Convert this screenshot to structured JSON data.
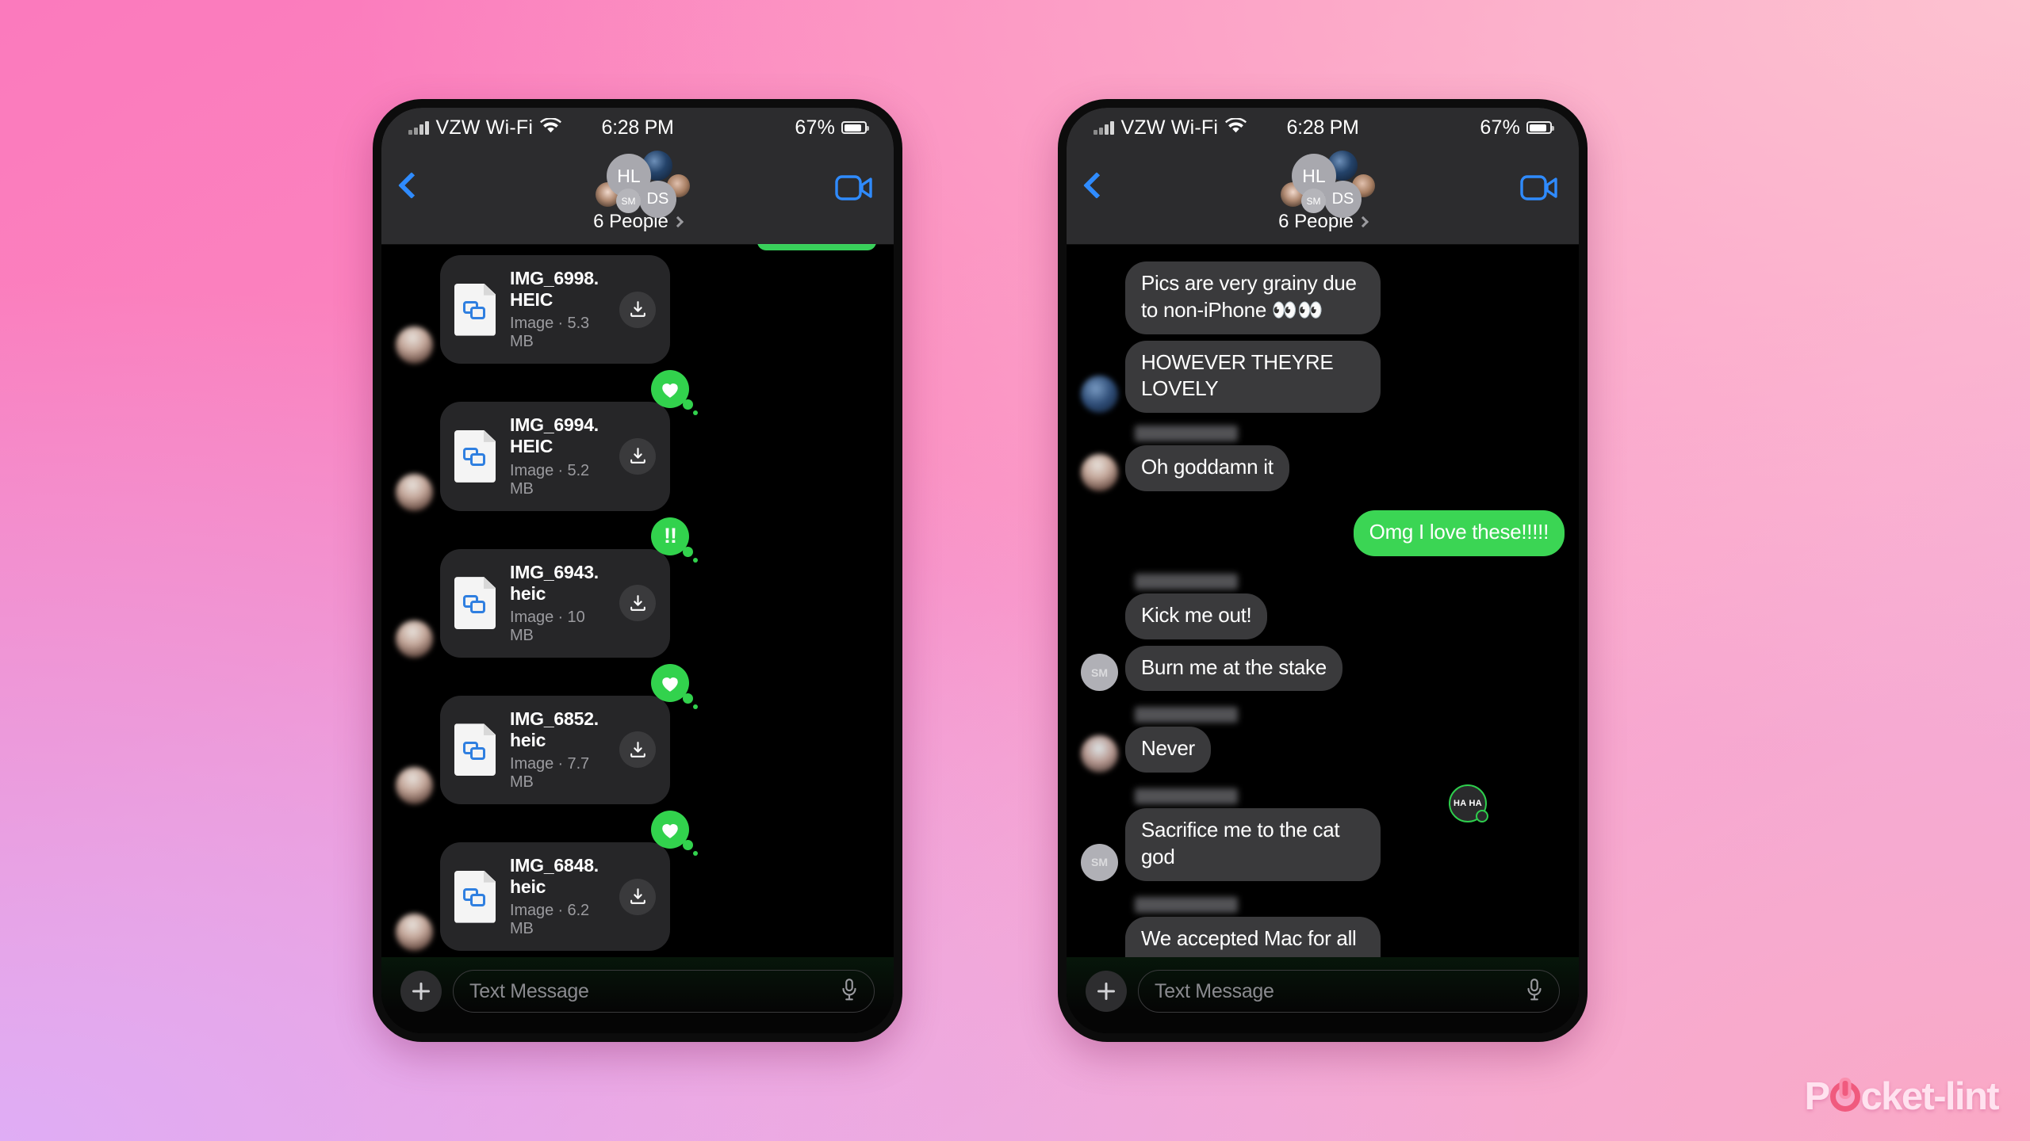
{
  "background": {
    "gradient_from": "#fb7abd",
    "gradient_to": "#dfadf5",
    "accent_pink": "#fcb6ca"
  },
  "watermark": {
    "text_before": "P",
    "text_after": "cket-lint",
    "icon": "power-symbol"
  },
  "status_bar": {
    "carrier": "VZW Wi-Fi",
    "wifi_icon": "wifi-icon",
    "time": "6:28 PM",
    "battery_percent": "67%",
    "battery_icon": "battery-icon",
    "signal_icon": "signal-bars-icon"
  },
  "nav": {
    "back_icon": "back-chevron-icon",
    "facetime_icon": "video-camera-icon",
    "people_label": "6 People",
    "people_chevron": "chevron-right-icon",
    "avatars": [
      {
        "initials": "HL",
        "type": "initials"
      },
      {
        "initials": "DS",
        "type": "initials"
      },
      {
        "initials": "SM",
        "type": "initials"
      },
      {
        "initials": "",
        "type": "photo"
      },
      {
        "initials": "",
        "type": "photo"
      },
      {
        "initials": "",
        "type": "photo"
      }
    ]
  },
  "composer": {
    "plus_icon": "plus-icon",
    "placeholder": "Text Message",
    "mic_icon": "microphone-icon"
  },
  "left_phone": {
    "download_icon": "download-icon",
    "file_icon": "heic-image-file-icon",
    "attachments": [
      {
        "name": "IMG_6998.HEIC",
        "meta": "Image · 5.3 MB",
        "reaction": null
      },
      {
        "name": "IMG_6994.HEIC",
        "meta": "Image · 5.2 MB",
        "reaction": "heart"
      },
      {
        "name": "IMG_6943.heic",
        "meta": "Image · 10 MB",
        "reaction": "exclamation"
      },
      {
        "name": "IMG_6852.heic",
        "meta": "Image · 7.7 MB",
        "reaction": "heart"
      },
      {
        "name": "IMG_6848.heic",
        "meta": "Image · 6.2 MB",
        "reaction": "heart"
      }
    ]
  },
  "right_phone": {
    "messages": [
      {
        "text": "Pics are very grainy due to non-iPhone 👀👀",
        "side": "in",
        "sender": null,
        "avatar": null,
        "reaction": null
      },
      {
        "text": "HOWEVER THEYRE LOVELY",
        "side": "in",
        "sender": null,
        "avatar": "photo-c",
        "reaction": null
      },
      {
        "text": "Oh goddamn it",
        "side": "in",
        "sender": "blurred",
        "avatar": "photo-a",
        "reaction": null
      },
      {
        "text": "Omg I love these!!!!!",
        "side": "out",
        "sender": null,
        "avatar": null,
        "reaction": null
      },
      {
        "text": "Kick me out!",
        "side": "in",
        "sender": "blurred",
        "avatar": null,
        "reaction": null
      },
      {
        "text": "Burn me at the stake",
        "side": "in",
        "sender": null,
        "avatar": "SM",
        "reaction": null
      },
      {
        "text": "Never",
        "side": "in",
        "sender": "blurred",
        "avatar": "photo-b",
        "reaction": null
      },
      {
        "text": "Sacrifice me to the cat god",
        "side": "in",
        "sender": "blurred",
        "avatar": "SM",
        "reaction": "haha"
      },
      {
        "text": "We accepted Mac for all these years and the cat god will not take you",
        "side": "in",
        "sender": "blurred",
        "avatar": "photo-a",
        "reaction": null
      }
    ],
    "reaction_haha_label": "HA HA"
  },
  "colors": {
    "bubble_in": "#3a3a3c",
    "bubble_out": "#3bd554",
    "reaction_green": "#32d24d",
    "accent_blue": "#2f8bff",
    "file_glyph_blue": "#2f7fe0"
  }
}
